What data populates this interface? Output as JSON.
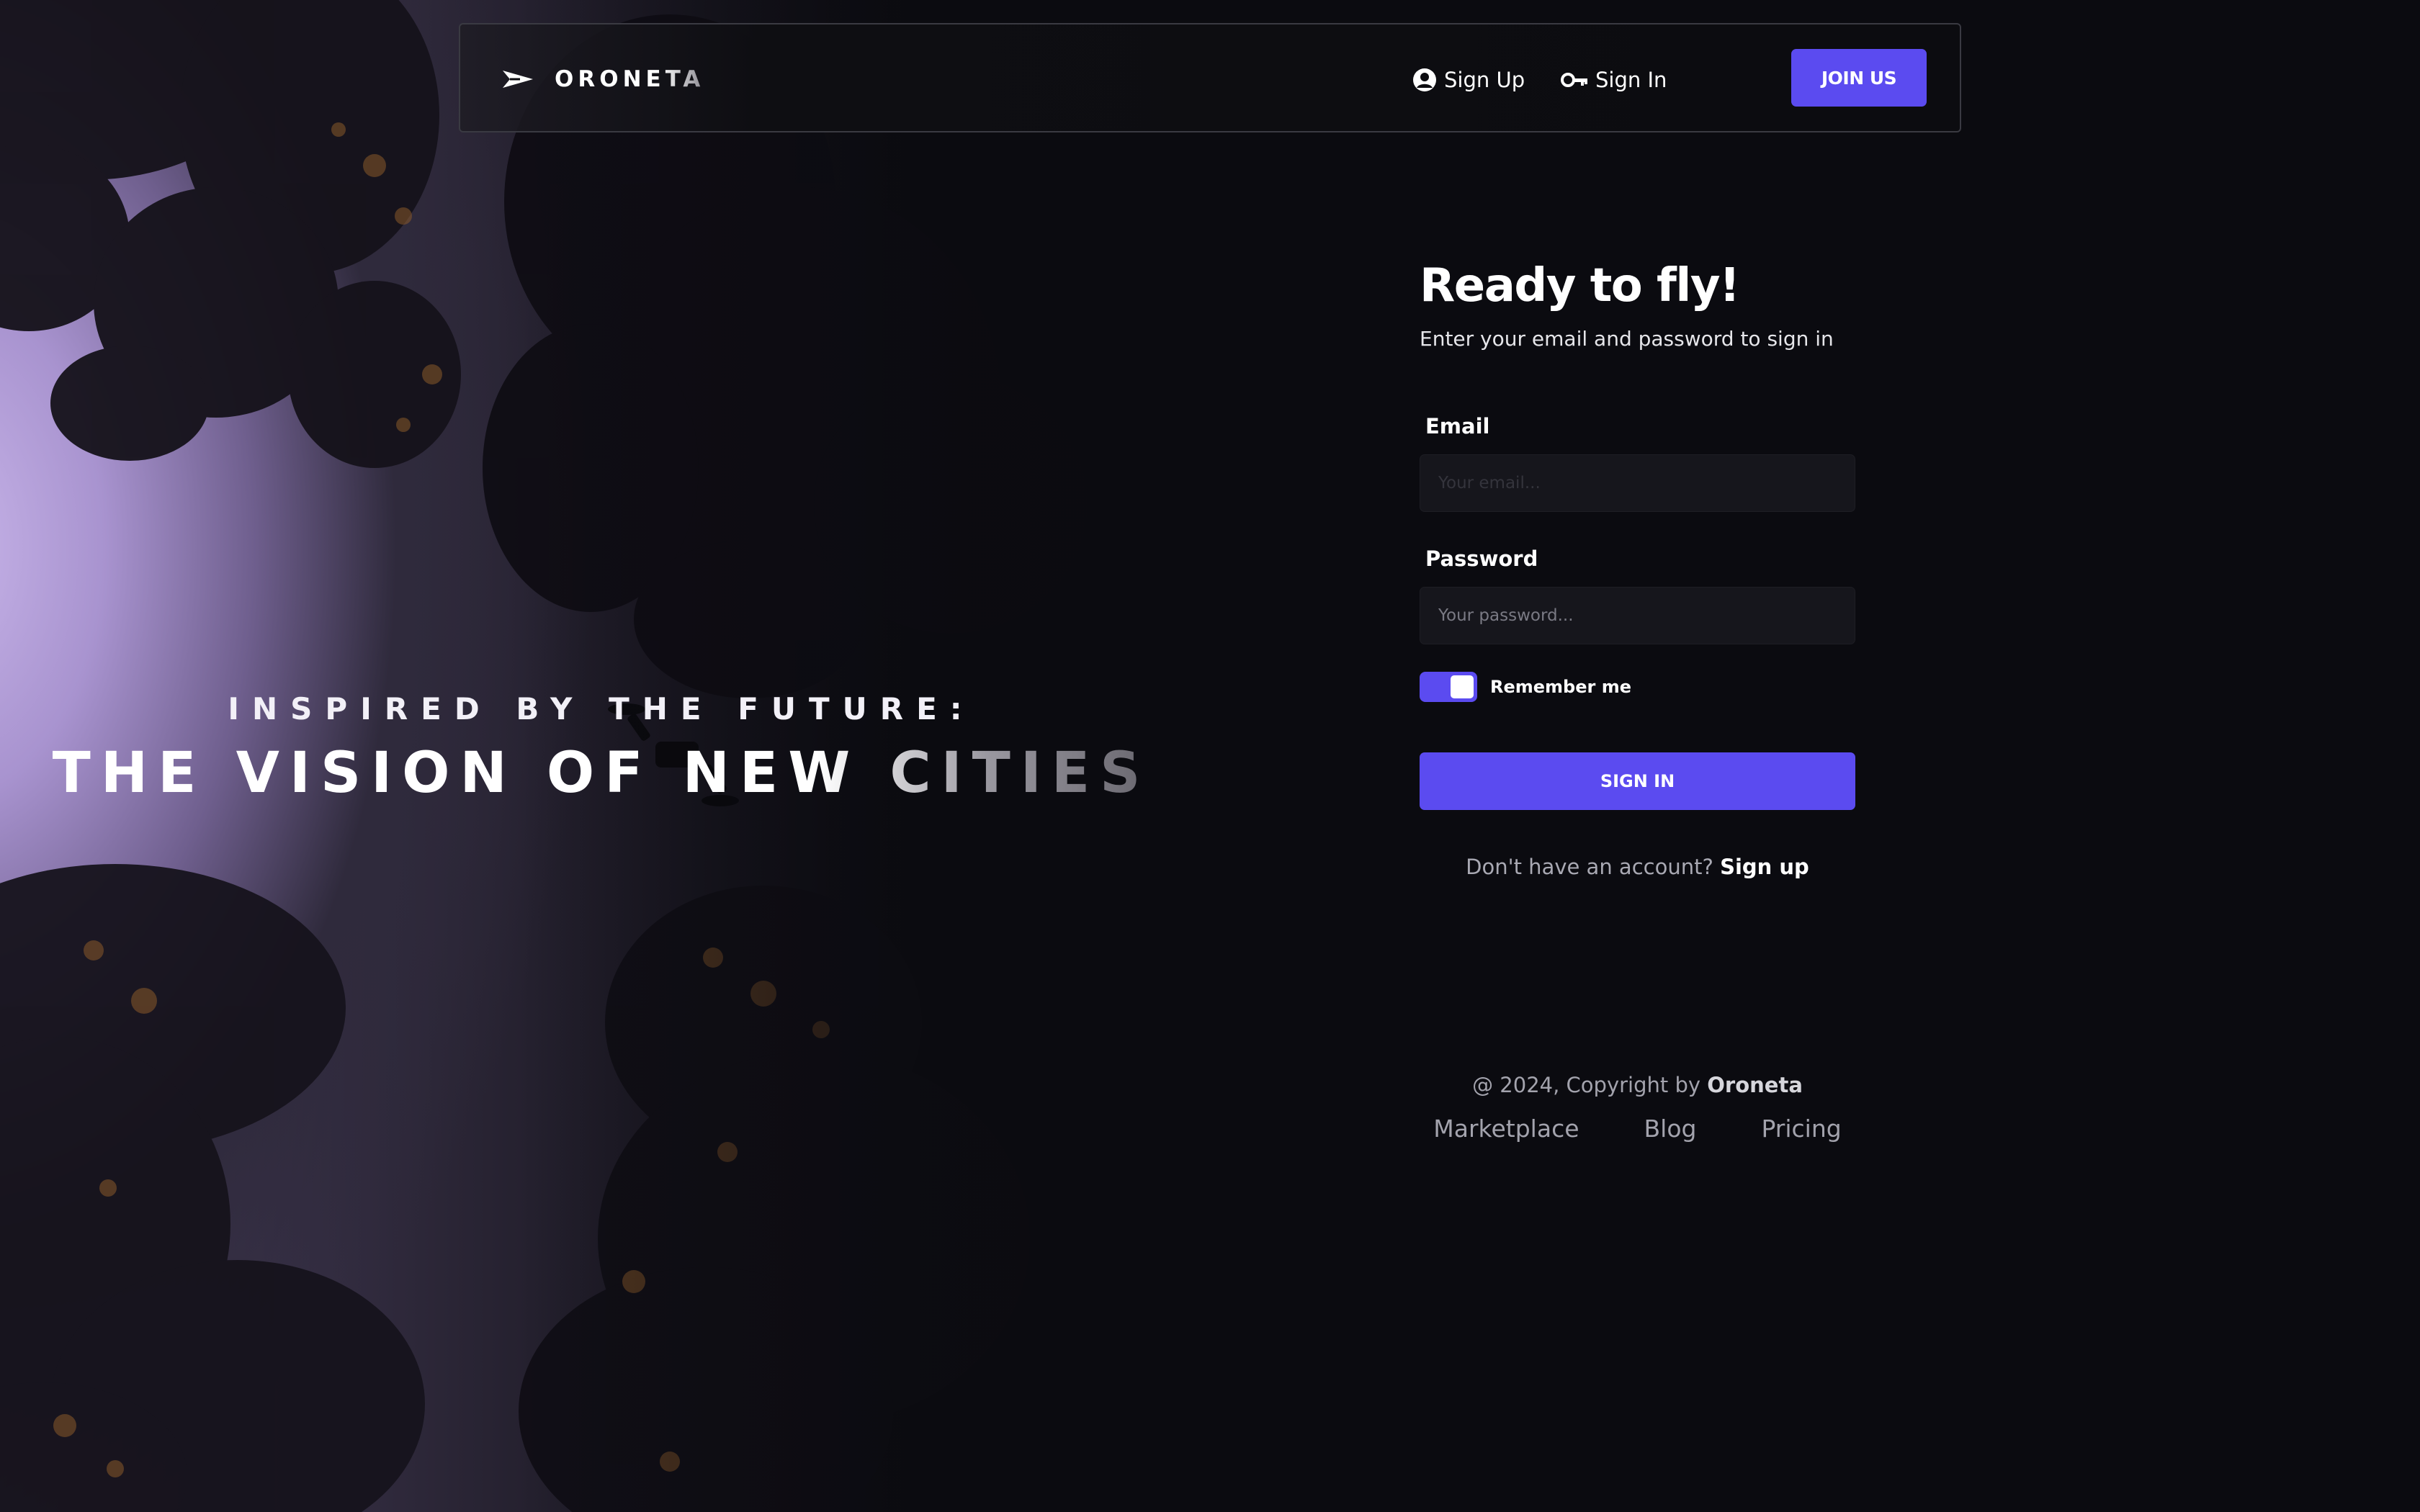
{
  "brand": {
    "name": "ORONETA",
    "icon": "plane-arrow-icon"
  },
  "nav": {
    "signup_label": "Sign Up",
    "signup_icon": "user-circle-icon",
    "signin_label": "Sign In",
    "signin_icon": "key-icon",
    "join_label": "JOIN US"
  },
  "hero": {
    "subtitle": "INSPIRED BY THE FUTURE:",
    "title": "THE VISION OF NEW CITIES"
  },
  "signin": {
    "title": "Ready to fly!",
    "subtitle": "Enter your email and password to sign in",
    "email_label": "Email",
    "email_placeholder": "Your email...",
    "email_value": "",
    "password_label": "Password",
    "password_placeholder": "Your password...",
    "password_value": "",
    "remember_label": "Remember me",
    "remember_checked": true,
    "submit_label": "SIGN IN",
    "no_account_text": "Don't have an account?",
    "signup_link": "Sign up"
  },
  "footer": {
    "copyright_prefix": "@ 2024, Copyright by",
    "copyright_brand": "Oroneta",
    "links": [
      "Marketplace",
      "Blog",
      "Pricing"
    ]
  },
  "colors": {
    "accent": "#5b4bf0",
    "background": "#0b0b10",
    "input_bg": "#16161c",
    "hero_glow": "#c9b6ea"
  }
}
